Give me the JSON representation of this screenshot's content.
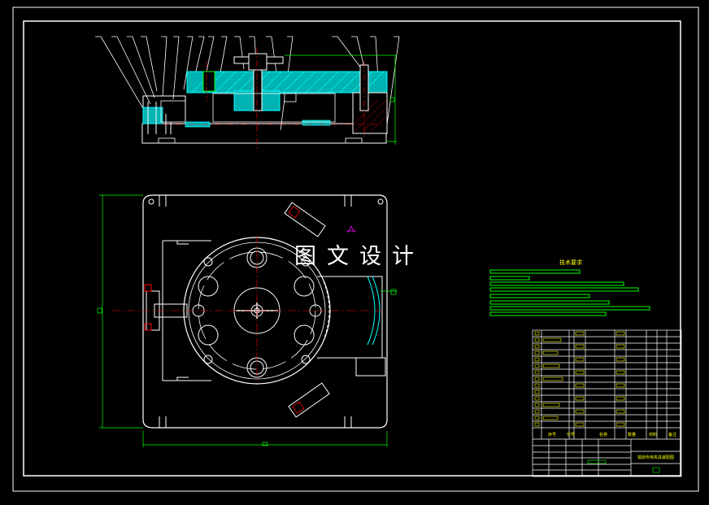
{
  "watermark": {
    "text": "图文设计"
  },
  "notes": {
    "title": "技术要求"
  },
  "title_block": {
    "drawing_title": "铣削专用夹具装配图",
    "header_cells": [
      "序号",
      "代号",
      "名称",
      "数量",
      "材料",
      "备注"
    ]
  },
  "colors": {
    "background": "#000000",
    "outline": "#ffffff",
    "section_hatch": "#00ffff",
    "dimension": "#00ff00",
    "centerline": "#ff0000",
    "text": "#ffff00",
    "annotation": "#ff00ff"
  }
}
